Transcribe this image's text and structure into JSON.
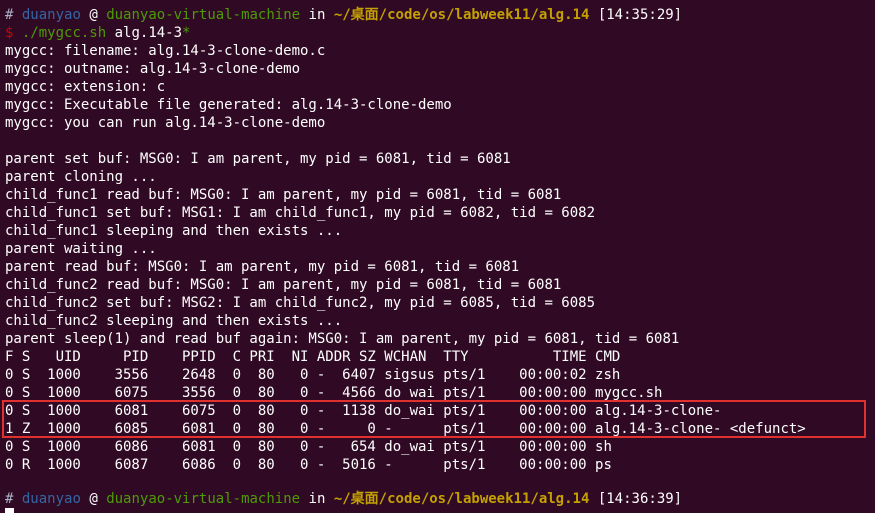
{
  "prompt1": {
    "hash": "#",
    "user": "duanyao",
    "at": "@",
    "host": "duanyao-virtual-machine",
    "in": "in",
    "path": "~/桌面/code/os/labweek11/alg.14",
    "time": "[14:35:29]"
  },
  "command": {
    "dollar": "$",
    "exec": "./mygcc.sh",
    "arg": "alg.14-3",
    "star": "*"
  },
  "output": [
    "mygcc: filename: alg.14-3-clone-demo.c",
    "mygcc: outname: alg.14-3-clone-demo",
    "mygcc: extension: c",
    "mygcc: Executable file generated: alg.14-3-clone-demo",
    "mygcc: you can run alg.14-3-clone-demo",
    "",
    "parent set buf: MSG0: I am parent, my pid = 6081, tid = 6081",
    "parent cloning ...",
    "child_func1 read buf: MSG0: I am parent, my pid = 6081, tid = 6081",
    "child_func1 set buf: MSG1: I am child_func1, my pid = 6082, tid = 6082",
    "child_func1 sleeping and then exists ...",
    "parent waiting ...",
    "parent read buf: MSG0: I am parent, my pid = 6081, tid = 6081",
    "child_func2 read buf: MSG0: I am parent, my pid = 6081, tid = 6081",
    "child_func2 set buf: MSG2: I am child_func2, my pid = 6085, tid = 6085",
    "child_func2 sleeping and then exists ...",
    "parent sleep(1) and read buf again: MSG0: I am parent, my pid = 6081, tid = 6081",
    "F S   UID     PID    PPID  C PRI  NI ADDR SZ WCHAN  TTY          TIME CMD",
    "0 S  1000    3556    2648  0  80   0 -  6407 sigsus pts/1    00:00:02 zsh",
    "0 S  1000    6075    3556  0  80   0 -  4566 do_wai pts/1    00:00:00 mygcc.sh",
    "0 S  1000    6081    6075  0  80   0 -  1138 do_wai pts/1    00:00:00 alg.14-3-clone-",
    "1 Z  1000    6085    6081  0  80   0 -     0 -      pts/1    00:00:00 alg.14-3-clone- <defunct>",
    "0 S  1000    6086    6081  0  80   0 -   654 do_wai pts/1    00:00:00 sh",
    "0 R  1000    6087    6086  0  80   0 -  5016 -      pts/1    00:00:00 ps",
    ""
  ],
  "prompt2": {
    "hash": "#",
    "user": "duanyao",
    "at": "@",
    "host": "duanyao-virtual-machine",
    "in": "in",
    "path": "~/桌面/code/os/labweek11/alg.14",
    "time": "[14:36:39]"
  },
  "colors": {
    "background": "#300a24",
    "user": "#3465a4",
    "host": "#4e9a06",
    "path": "#c4a000",
    "dollar": "#cc0000",
    "highlight_box": "#e0312e"
  }
}
